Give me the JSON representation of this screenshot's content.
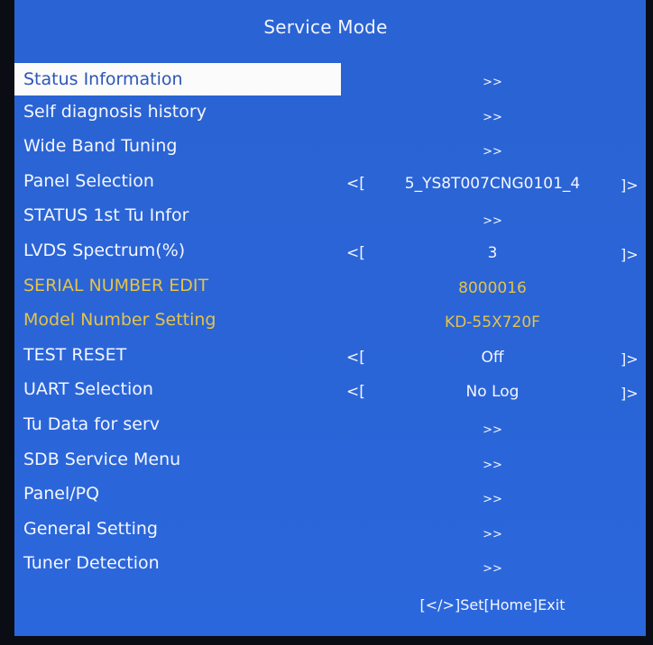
{
  "title": "Service Mode",
  "menu": [
    {
      "label": "Status Information",
      "value": ">>"
    },
    {
      "label": "Self diagnosis history",
      "value": ">>"
    },
    {
      "label": "Wide Band Tuning",
      "value": ">>"
    },
    {
      "label": "Panel Selection",
      "value": "5_YS8T007CNG0101_4",
      "left": "<[",
      "right": "]>"
    },
    {
      "label": "STATUS 1st Tu Infor",
      "value": ">>"
    },
    {
      "label": "LVDS Spectrum(%)",
      "value": "3",
      "left": "<[",
      "right": "]>"
    },
    {
      "label": "SERIAL NUMBER EDIT",
      "value": "8000016"
    },
    {
      "label": "Model Number Setting",
      "value": "KD-55X720F"
    },
    {
      "label": "TEST RESET",
      "value": "Off",
      "left": "<[",
      "right": "]>"
    },
    {
      "label": "UART Selection",
      "value": "No Log",
      "left": "<[",
      "right": "]>"
    },
    {
      "label": "Tu Data for serv",
      "value": ">>"
    },
    {
      "label": "SDB Service Menu",
      "value": ">>"
    },
    {
      "label": "Panel/PQ",
      "value": ">>"
    },
    {
      "label": "General Setting",
      "value": ">>"
    },
    {
      "label": "Tuner Detection",
      "value": ">>"
    }
  ],
  "footer": "[</>]Set[Home]Exit",
  "colors": {
    "background": "#2a64d6",
    "highlight": "#fbfbfb",
    "highlight_text": "#2d55b8",
    "yellow_text": "#e4c34a",
    "text": "#f4f6ff"
  }
}
